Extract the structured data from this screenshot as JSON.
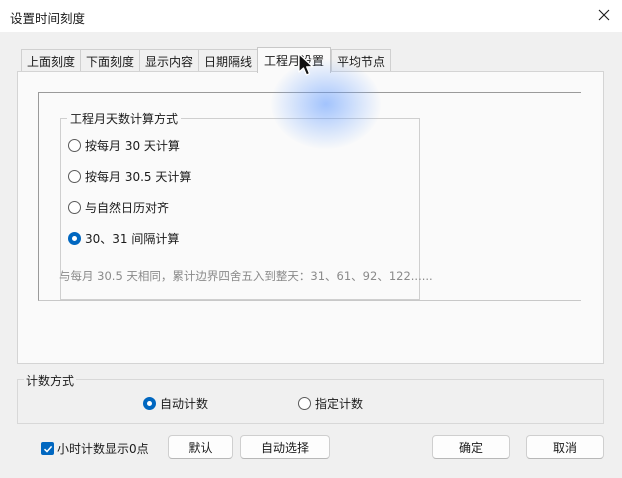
{
  "window": {
    "title": "设置时间刻度"
  },
  "tabs": [
    {
      "label": "上面刻度"
    },
    {
      "label": "下面刻度"
    },
    {
      "label": "显示内容"
    },
    {
      "label": "日期隔线"
    },
    {
      "label": "工程月设置",
      "active": true
    },
    {
      "label": "平均节点"
    }
  ],
  "month_days": {
    "title": "工程月天数计算方式",
    "options": [
      {
        "label": "按每月 30 天计算",
        "checked": false
      },
      {
        "label": "按每月 30.5 天计算",
        "checked": false
      },
      {
        "label": "与自然日历对齐",
        "checked": false
      },
      {
        "label": "30、31 间隔计算",
        "checked": true
      }
    ],
    "hint": "与每月 30.5 天相同，累计边界四舍五入到整天：31、61、92、122......"
  },
  "count_mode": {
    "title": "计数方式",
    "options": [
      {
        "label": "自动计数",
        "checked": true
      },
      {
        "label": "指定计数",
        "checked": false
      }
    ]
  },
  "footer": {
    "show_zero_hour": {
      "label": "小时计数显示0点",
      "checked": true
    },
    "default_label": "默认",
    "auto_select_label": "自动选择",
    "ok_label": "确定",
    "cancel_label": "取消"
  },
  "colors": {
    "accent": "#0067c0",
    "hint_text": "#8a8a8a",
    "cursor_glow": "#5a96ff"
  },
  "icons": [
    "close-icon",
    "mouse-cursor-icon",
    "checkmark-icon"
  ]
}
